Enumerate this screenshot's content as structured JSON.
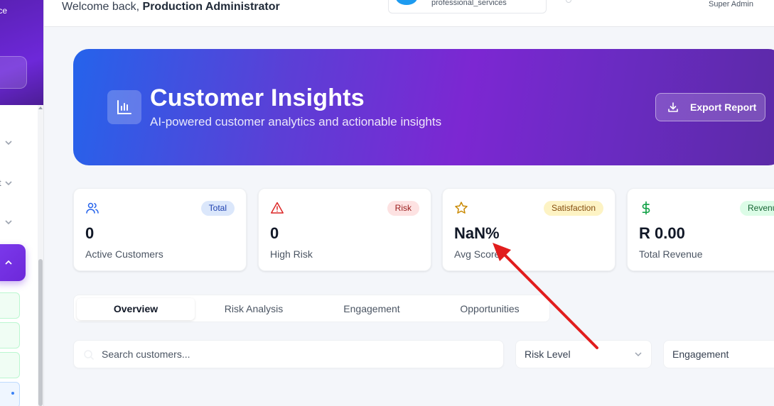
{
  "sidebar": {
    "brand_fragment": "ce",
    "fragment_text": "t"
  },
  "topbar": {
    "welcome_prefix": "Welcome back, ",
    "welcome_name": "Production Administrator",
    "tenant": "professional_services",
    "user_role": "Super Admin"
  },
  "hero": {
    "title": "Customer Insights",
    "subtitle": "AI-powered customer analytics and actionable insights",
    "export_label": "Export Report",
    "icon": "bar-chart-icon",
    "gradient_colors": [
      "#2563eb",
      "#7c27d2",
      "#5b2aa6"
    ]
  },
  "stats": [
    {
      "badge": "Total",
      "value": "0",
      "label": "Active Customers",
      "icon": "users-icon",
      "icon_color": "#2563eb",
      "badge_bg": "#dbe7fb",
      "badge_color": "#1e40af"
    },
    {
      "badge": "Risk",
      "value": "0",
      "label": "High Risk",
      "icon": "alert-triangle-icon",
      "icon_color": "#dc2626",
      "badge_bg": "#fde2e2",
      "badge_color": "#991b1b"
    },
    {
      "badge": "Satisfaction",
      "value": "NaN%",
      "label": "Avg Score",
      "icon": "star-icon",
      "icon_color": "#ca8a04",
      "badge_bg": "#fdf3c4",
      "badge_color": "#854d0e"
    },
    {
      "badge": "Revenue",
      "value": "R 0.00",
      "label": "Total Revenue",
      "icon": "dollar-icon",
      "icon_color": "#16a34a",
      "badge_bg": "#dcfce7",
      "badge_color": "#166534"
    }
  ],
  "tabs": [
    "Overview",
    "Risk Analysis",
    "Engagement",
    "Opportunities"
  ],
  "active_tab": "Overview",
  "filters": {
    "search_placeholder": "Search customers...",
    "risk_level": "Risk Level",
    "engagement": "Engagement"
  },
  "annotation": {
    "color": "#e11d1d"
  }
}
